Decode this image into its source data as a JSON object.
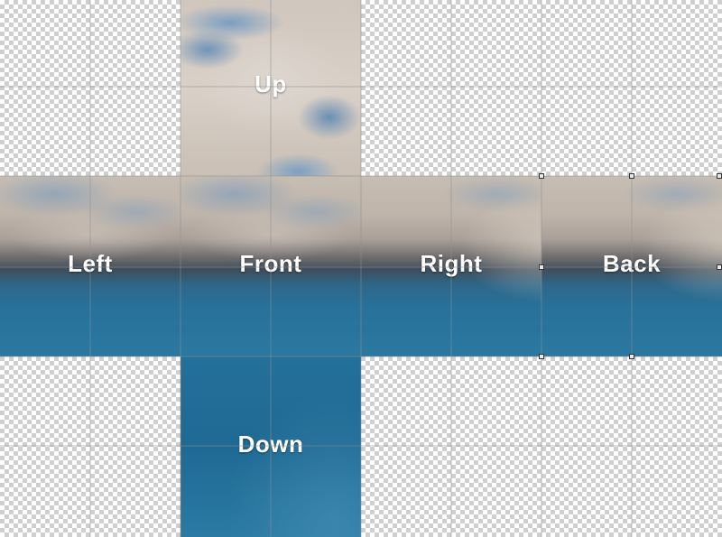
{
  "faces": {
    "up": "Up",
    "left": "Left",
    "front": "Front",
    "right": "Right",
    "back": "Back",
    "down": "Down"
  },
  "colors": {
    "checker_light": "#ffffff",
    "checker_dark": "#cfcfcf",
    "sky": "#cfc6bd",
    "ocean": "#23709a",
    "label": "#ffffff"
  }
}
